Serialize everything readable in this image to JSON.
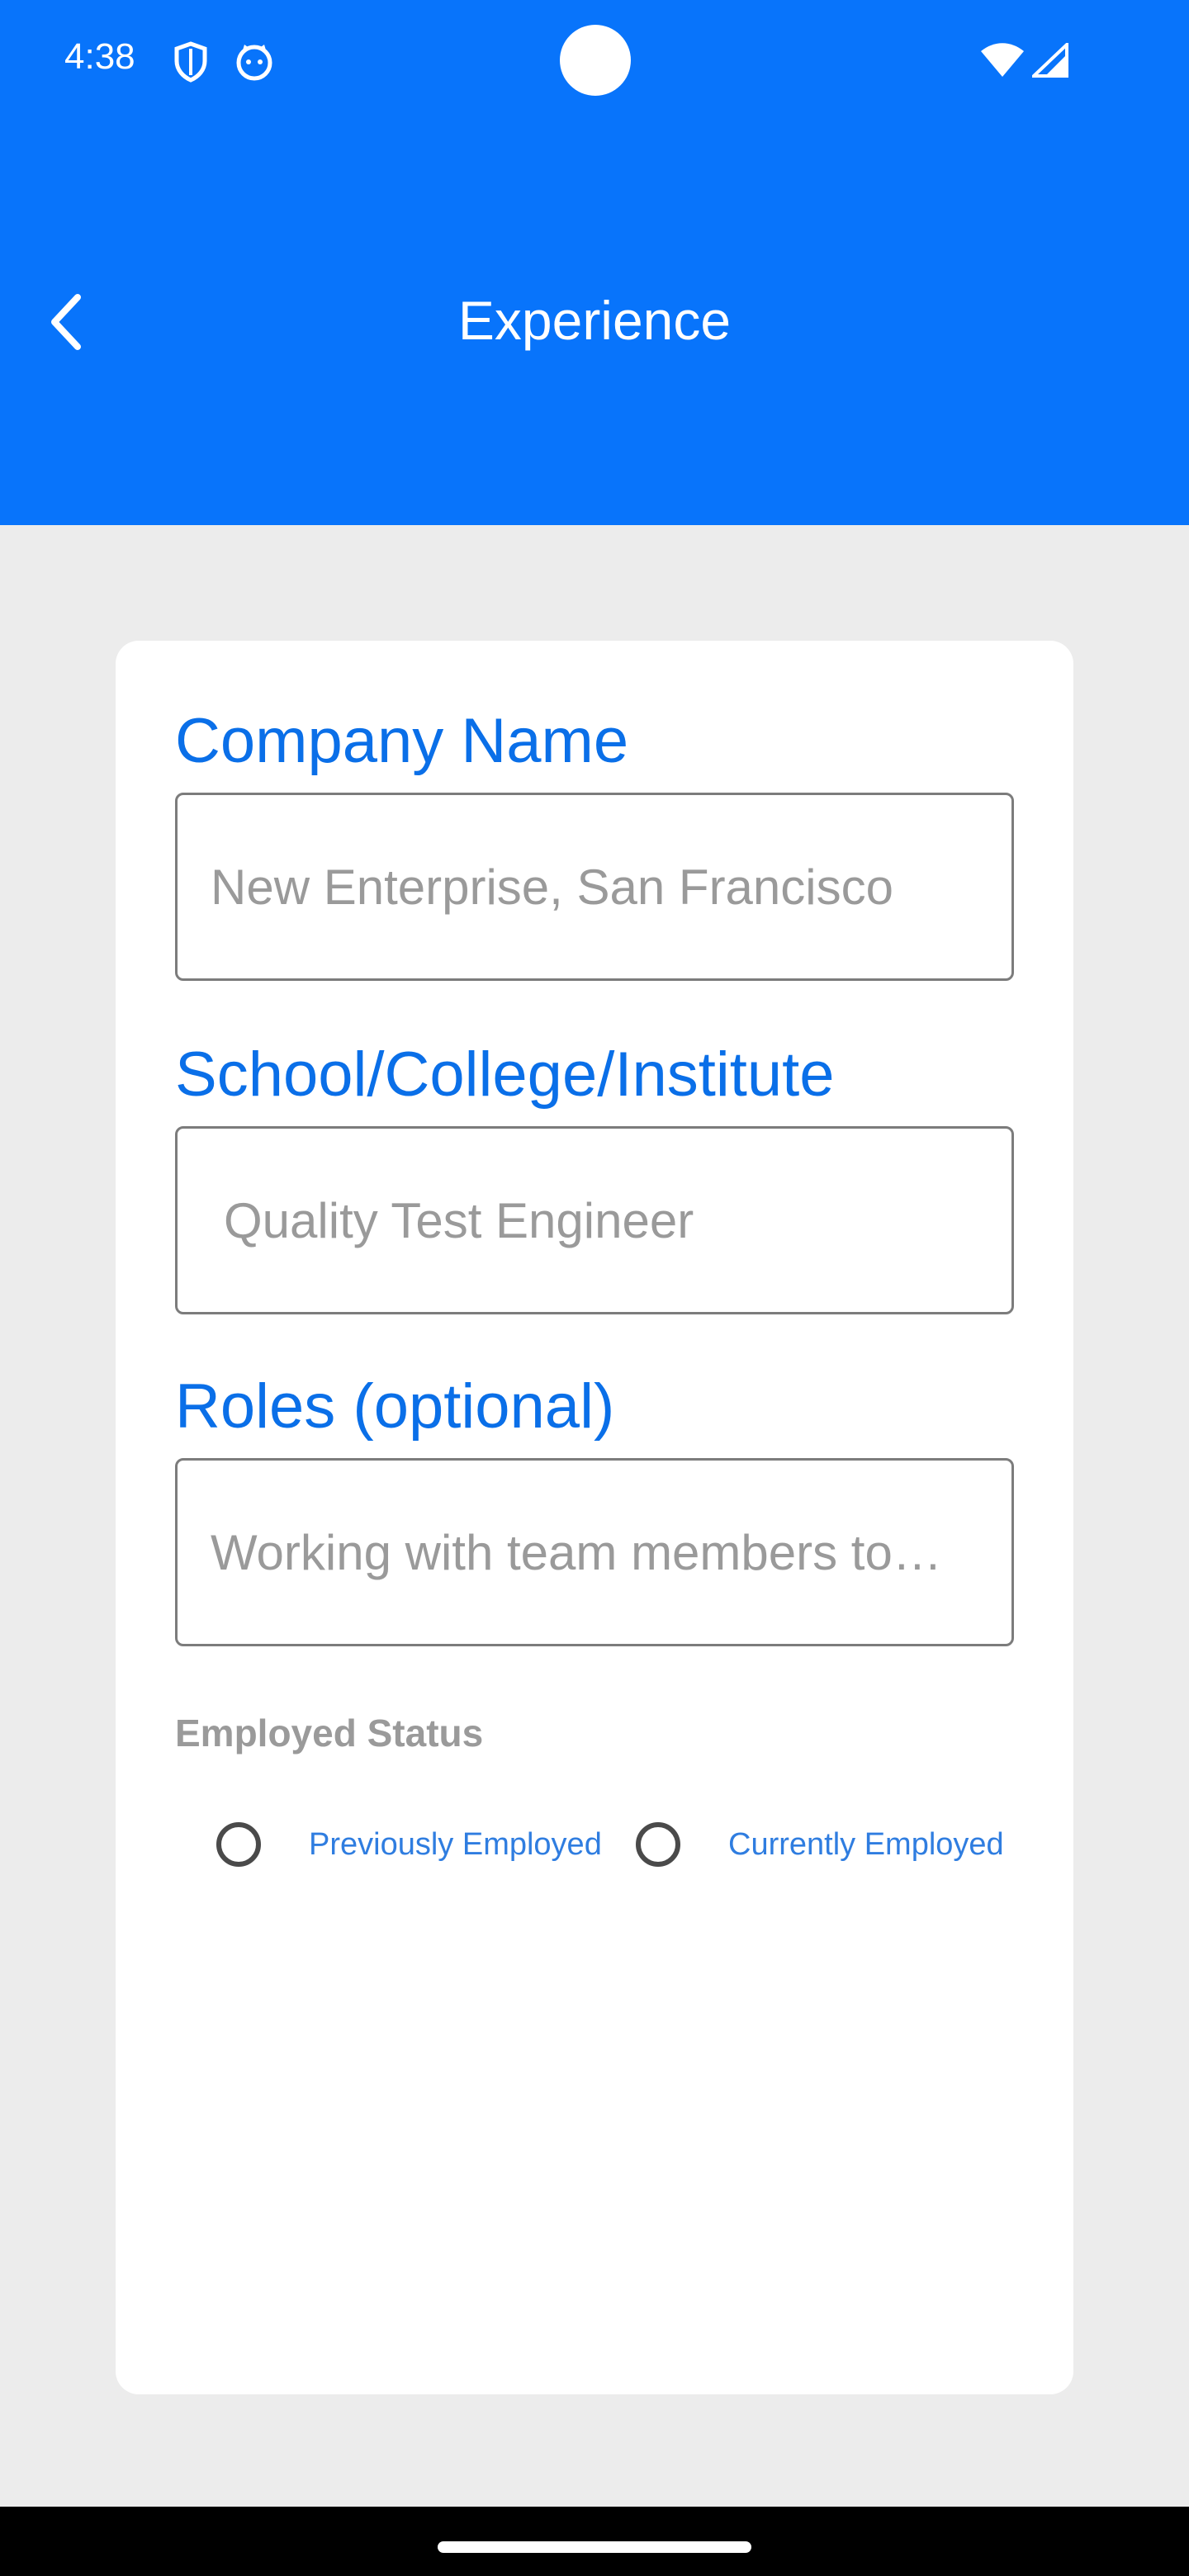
{
  "status_bar": {
    "time": "4:38",
    "icons": [
      "shield-icon",
      "cat-face-icon",
      "wifi-icon",
      "cell-signal-icon"
    ]
  },
  "app_bar": {
    "title": "Experience",
    "back_icon": "chevron-left-icon",
    "color": "#0874fb"
  },
  "form": {
    "company_name": {
      "label": "Company Name",
      "placeholder": "New Enterprise, San Francisco"
    },
    "school": {
      "label": "School/College/Institute",
      "placeholder": "Quality Test Engineer"
    },
    "roles": {
      "label": "Roles (optional)",
      "placeholder": "Working with team members to…"
    },
    "employed_status": {
      "heading": "Employed Status",
      "options": [
        {
          "label": "Previously Employed",
          "selected": false
        },
        {
          "label": "Currently Employed",
          "selected": false
        }
      ]
    }
  },
  "colors": {
    "accent": "#0a6fe8",
    "background": "#ececec",
    "card": "#ffffff"
  }
}
